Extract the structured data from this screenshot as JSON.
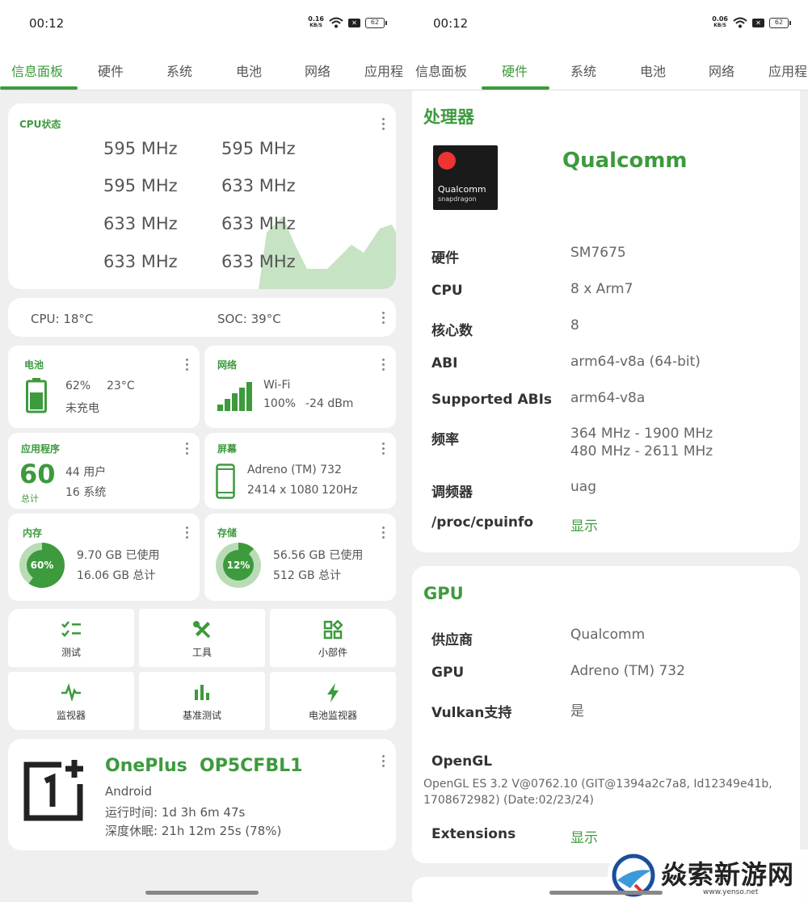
{
  "left": {
    "status": {
      "time": "00:12",
      "net_speed_value": "0.16",
      "net_speed_unit": "KB/S",
      "battery": "62"
    },
    "tabs": [
      "信息面板",
      "硬件",
      "系统",
      "电池",
      "网络",
      "应用程"
    ],
    "active_tab": "信息面板",
    "cpu": {
      "title": "CPU状态",
      "freqs": [
        "595 MHz",
        "595 MHz",
        "595 MHz",
        "633 MHz",
        "633 MHz",
        "633 MHz",
        "633 MHz",
        "633 MHz"
      ]
    },
    "temps": {
      "cpu": "CPU: 18°C",
      "soc": "SOC: 39°C"
    },
    "battery": {
      "title": "电池",
      "percent": "62%",
      "temp": "23°C",
      "state": "未充电",
      "level": 0.62
    },
    "network": {
      "title": "网络",
      "type": "Wi-Fi",
      "signal": "100%",
      "dbm": "-24 dBm"
    },
    "apps": {
      "title": "应用程序",
      "total": "60",
      "total_label": "总计",
      "user": "44 用户",
      "system": "16 系统"
    },
    "screen": {
      "title": "屏幕",
      "gpu": "Adreno (TM) 732",
      "res": "2414 x 1080",
      "hz": "120Hz"
    },
    "memory": {
      "title": "内存",
      "pct_label": "60%",
      "pct": 0.6,
      "used": "9.70 GB 已使用",
      "total": "16.06 GB 总计"
    },
    "storage": {
      "title": "存储",
      "pct_label": "12%",
      "pct": 0.12,
      "used": "56.56 GB 已使用",
      "total": "512 GB 总计"
    },
    "tools": [
      {
        "label": "测试",
        "icon": "checklist-icon"
      },
      {
        "label": "工具",
        "icon": "tools-icon"
      },
      {
        "label": "小部件",
        "icon": "widgets-icon"
      },
      {
        "label": "监视器",
        "icon": "pulse-icon"
      },
      {
        "label": "基准测试",
        "icon": "bar-chart-icon"
      },
      {
        "label": "电池监视器",
        "icon": "bolt-icon"
      }
    ],
    "device": {
      "name": "OnePlus  OP5CFBL1",
      "os": "Android",
      "uptime": "运行时间: 1d 3h 6m 47s",
      "deep_sleep": "深度休眠: 21h 12m 25s (78%)"
    }
  },
  "right": {
    "status": {
      "time": "00:12",
      "net_speed_value": "0.06",
      "net_speed_unit": "KB/S",
      "battery": "62"
    },
    "tabs": [
      "信息面板",
      "硬件",
      "系统",
      "电池",
      "网络",
      "应用程"
    ],
    "active_tab": "硬件",
    "processor": {
      "title": "处理器",
      "vendor": "Qualcomm",
      "logo_text": "Qualcomm",
      "logo_sub": "snapdragon",
      "rows": [
        {
          "k": "硬件",
          "v": "SM7675"
        },
        {
          "k": "CPU",
          "v": "8 x Arm7"
        },
        {
          "k": "核心数",
          "v": "8"
        },
        {
          "k": "ABI",
          "v": "arm64-v8a (64-bit)"
        },
        {
          "k": "Supported ABIs",
          "v": "arm64-v8a"
        },
        {
          "k": "频率",
          "v": "364 MHz - 1900 MHz",
          "v2": "480 MHz - 2611 MHz"
        },
        {
          "k": "调频器",
          "v": "uag"
        }
      ],
      "cpuinfo_label": "/proc/cpuinfo",
      "cpuinfo_link": "显示"
    },
    "gpu": {
      "title": "GPU",
      "rows": [
        {
          "k": "供应商",
          "v": "Qualcomm"
        },
        {
          "k": "GPU",
          "v": "Adreno (TM) 732"
        },
        {
          "k": "Vulkan支持",
          "v": "是"
        }
      ],
      "opengl_label": "OpenGL",
      "opengl_line1": "OpenGL ES 3.2 V@0762.10 (GIT@1394a2c7a8, Id12349e41b,",
      "opengl_line2": "1708672982) (Date:02/23/24)",
      "ext_label": "Extensions",
      "ext_link": "显示"
    },
    "watermark": {
      "brand": "焱索新游网",
      "url": "www.yenso.net"
    }
  }
}
